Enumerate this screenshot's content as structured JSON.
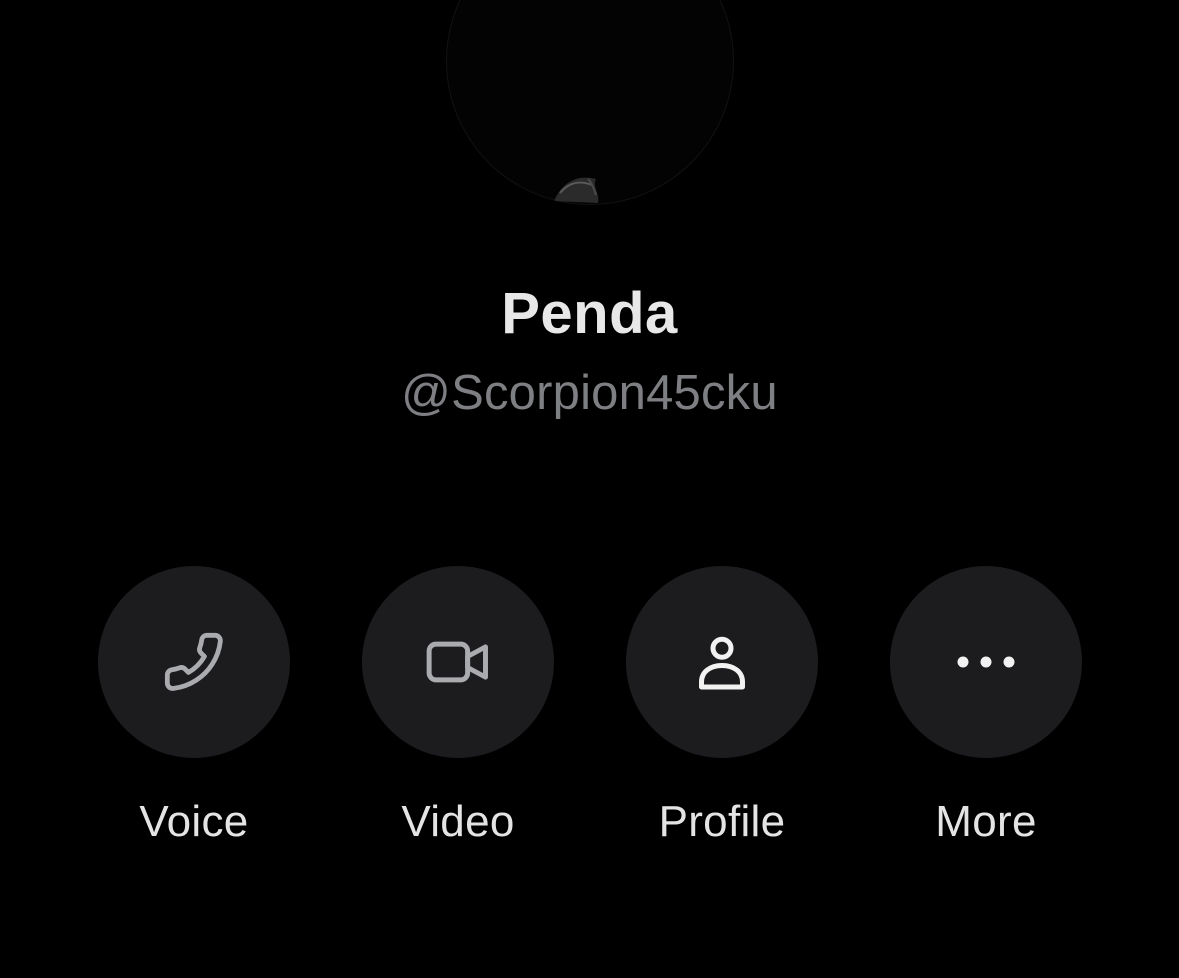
{
  "profile": {
    "display_name": "Penda",
    "username": "@Scorpion45cku"
  },
  "actions": [
    {
      "label": "Voice",
      "icon": "phone-icon"
    },
    {
      "label": "Video",
      "icon": "video-camera-icon"
    },
    {
      "label": "Profile",
      "icon": "person-icon"
    },
    {
      "label": "More",
      "icon": "ellipsis-icon"
    }
  ],
  "colors": {
    "background": "#000000",
    "button_background": "#1c1c1f",
    "name_text": "#e8e8e8",
    "username_text": "#7d7f83",
    "label_text": "#e4e4e4",
    "icon_muted": "#a9abaf",
    "icon_bright": "#f2f2f2"
  }
}
